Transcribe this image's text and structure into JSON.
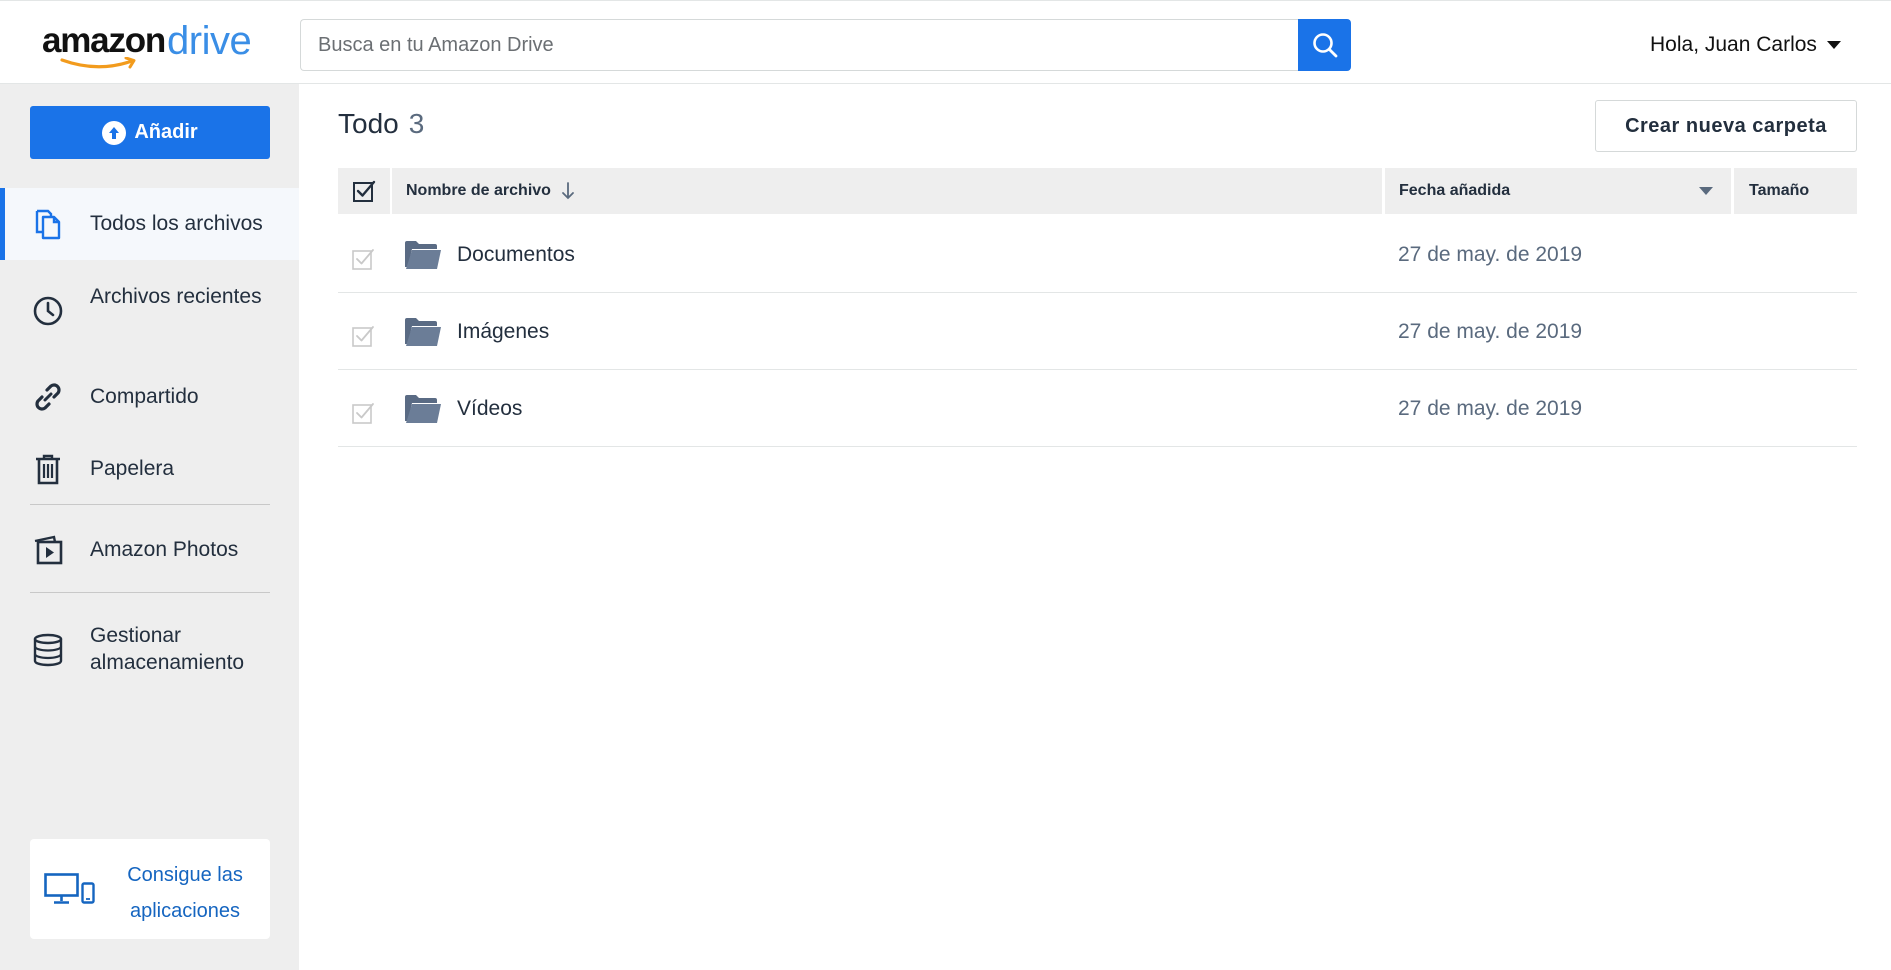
{
  "header": {
    "logo_amazon": "amazon",
    "logo_drive": "drive",
    "search_placeholder": "Busca en tu Amazon Drive",
    "search_icon": "search-icon",
    "greeting": "Hola, Juan Carlos",
    "accent_color": "#1a73e8"
  },
  "sidebar": {
    "add_label": "Añadir",
    "items": [
      {
        "label": "Todos los archivos",
        "icon": "files-icon",
        "active": true
      },
      {
        "label": "Archivos recientes",
        "icon": "clock-icon"
      },
      {
        "label": "Compartido",
        "icon": "link-icon"
      },
      {
        "label": "Papelera",
        "icon": "trash-icon"
      },
      {
        "label": "Amazon Photos",
        "icon": "photos-icon"
      },
      {
        "label": "Gestionar almacenamiento",
        "icon": "storage-icon"
      }
    ],
    "apps_label": "Consigue las aplicaciones"
  },
  "main": {
    "title": "Todo",
    "count": "3",
    "new_folder_label": "Crear nueva carpeta",
    "columns": {
      "name": "Nombre de archivo",
      "date": "Fecha añadida",
      "size": "Tamaño"
    },
    "rows": [
      {
        "name": "Documentos",
        "date": "27 de may. de 2019"
      },
      {
        "name": "Imágenes",
        "date": "27 de may. de 2019"
      },
      {
        "name": "Vídeos",
        "date": "27 de may. de 2019"
      }
    ]
  }
}
